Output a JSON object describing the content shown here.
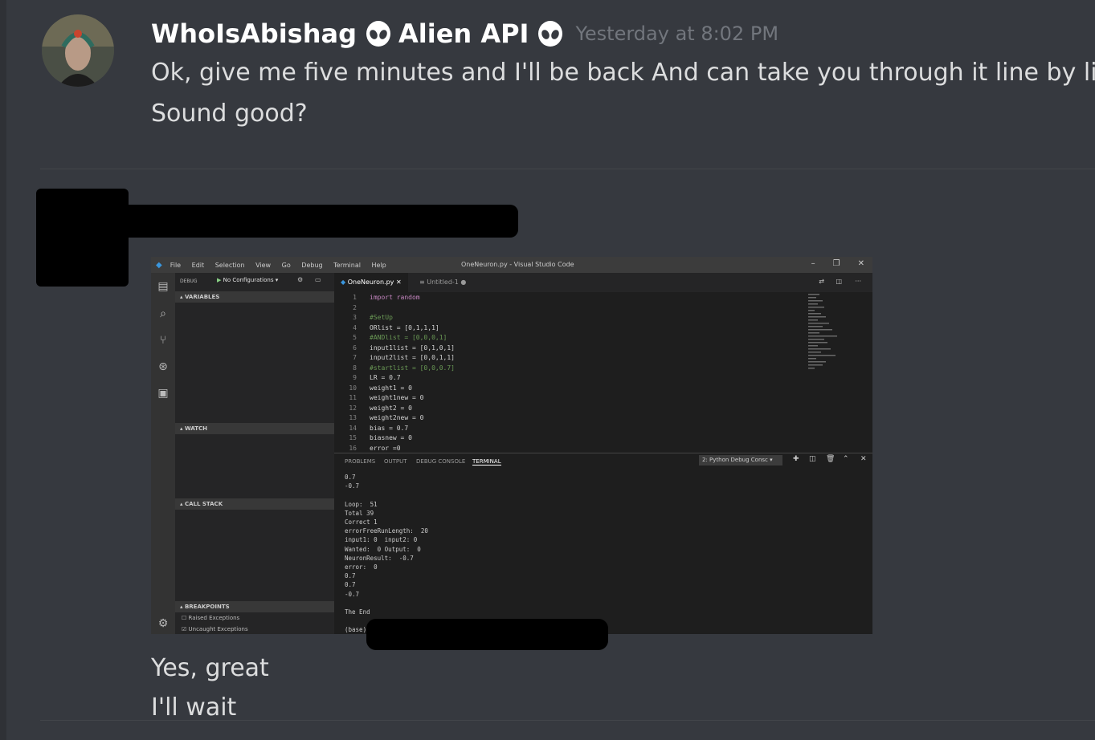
{
  "message": {
    "username": "WhoIsAbishag",
    "role_tag": "Alien API",
    "timestamp": "Yesterday at 8:02 PM",
    "lines": [
      "Ok, give me five minutes and I'll be back And can take you through it line by line",
      "Sound good?"
    ],
    "reply_lines": [
      "Yes, great",
      "I'll wait"
    ]
  },
  "vscode": {
    "menu": [
      "File",
      "Edit",
      "Selection",
      "View",
      "Go",
      "Debug",
      "Terminal",
      "Help"
    ],
    "window_title": "OneNeuron.py - Visual Studio Code",
    "debug_label": "DEBUG",
    "config": "No Configurations",
    "tabs": [
      "OneNeuron.py",
      "Untitled-1"
    ],
    "sections": [
      "VARIABLES",
      "WATCH",
      "CALL STACK",
      "BREAKPOINTS"
    ],
    "breakpoints": [
      "Raised Exceptions",
      "Uncaught Exceptions"
    ],
    "code": [
      {
        "n": "1",
        "t": "import random",
        "c": "kw"
      },
      {
        "n": "2",
        "t": "",
        "c": ""
      },
      {
        "n": "3",
        "t": "#SetUp",
        "c": "cm"
      },
      {
        "n": "4",
        "t": "ORlist = [0,1,1,1]",
        "c": ""
      },
      {
        "n": "5",
        "t": "#ANDlist = [0,0,0,1]",
        "c": "cm"
      },
      {
        "n": "6",
        "t": "input1list = [0,1,0,1]",
        "c": ""
      },
      {
        "n": "7",
        "t": "input2list = [0,0,1,1]",
        "c": ""
      },
      {
        "n": "8",
        "t": "#startlist = [0,0,0.7]",
        "c": "cm"
      },
      {
        "n": "9",
        "t": "LR = 0.7",
        "c": ""
      },
      {
        "n": "10",
        "t": "weight1 = 0",
        "c": ""
      },
      {
        "n": "11",
        "t": "weight1new = 0",
        "c": ""
      },
      {
        "n": "12",
        "t": "weight2 = 0",
        "c": ""
      },
      {
        "n": "13",
        "t": "weight2new = 0",
        "c": ""
      },
      {
        "n": "14",
        "t": "bias = 0.7",
        "c": ""
      },
      {
        "n": "15",
        "t": "biasnew = 0",
        "c": ""
      },
      {
        "n": "16",
        "t": "error =0",
        "c": ""
      }
    ],
    "panel_tabs": [
      "PROBLEMS",
      "OUTPUT",
      "DEBUG CONSOLE",
      "TERMINAL"
    ],
    "terminal_select": "2: Python Debug Consc",
    "terminal": [
      "0.7",
      "-0.7",
      "",
      "Loop:  51",
      "Total 39",
      "Correct 1",
      "errorFreeRunLength:  20",
      "input1: 0  input2: 0",
      "Wanted:  0 Output:  0",
      "NeuronResult:  -0.7",
      "error:  0",
      "0.7",
      "0.7",
      "-0.7",
      "",
      "The End",
      "",
      "(base)"
    ]
  }
}
